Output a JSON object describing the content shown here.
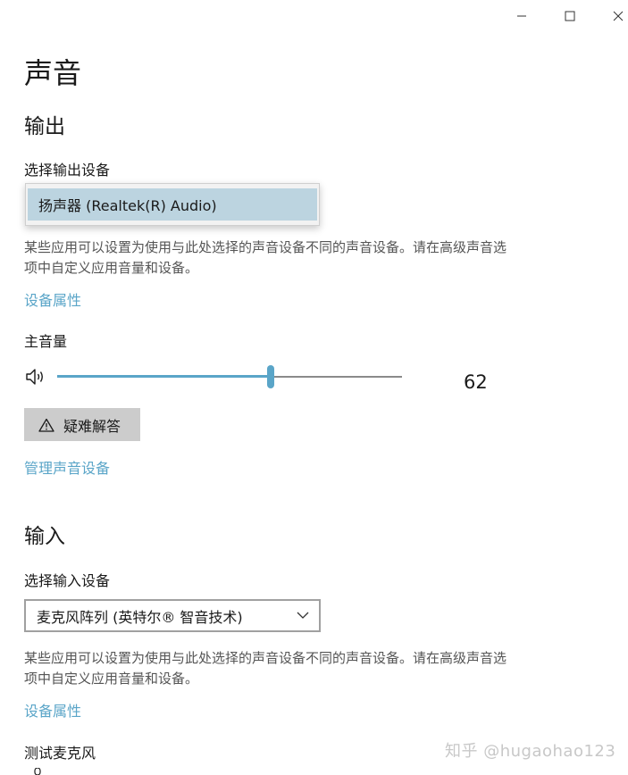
{
  "window": {
    "minimize_icon": "minimize-icon",
    "maximize_icon": "maximize-icon",
    "close_icon": "close-icon"
  },
  "page": {
    "title": "声音"
  },
  "output": {
    "heading": "输出",
    "select_label": "选择输出设备",
    "selected_device": "扬声器 (Realtek(R) Audio)",
    "description": "某些应用可以设置为使用与此处选择的声音设备不同的声音设备。请在高级声音选项中自定义应用音量和设备。",
    "device_properties_link": "设备属性",
    "volume_label": "主音量",
    "volume_value": "62",
    "volume_fraction": 0.62,
    "troubleshoot_label": "疑难解答",
    "manage_devices_link": "管理声音设备"
  },
  "input": {
    "heading": "输入",
    "select_label": "选择输入设备",
    "selected_device": "麦克风阵列 (英特尔® 智音技术)",
    "description": "某些应用可以设置为使用与此处选择的声音设备不同的声音设备。请在高级声音选项中自定义应用音量和设备。",
    "device_properties_link": "设备属性",
    "test_mic_label": "测试麦克风"
  },
  "watermark": "知乎 @hugaohao123",
  "colors": {
    "accent": "#5aa5c8",
    "selected_option_bg": "#bcd4e0",
    "button_bg": "#cccccc",
    "description_text": "#555555"
  }
}
